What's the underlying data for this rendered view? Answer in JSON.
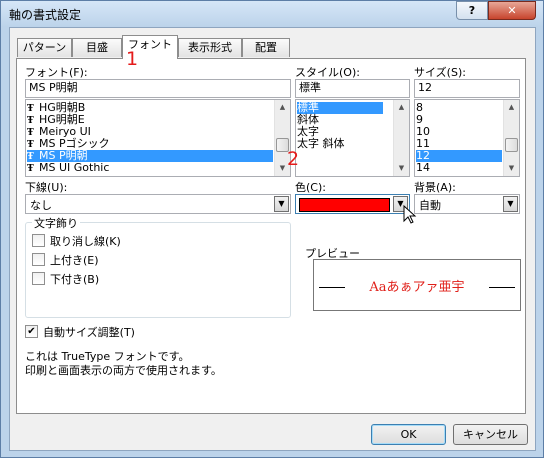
{
  "window": {
    "title": "軸の書式設定",
    "help_label": "?",
    "close_label": "✕"
  },
  "tabs": [
    {
      "label": "パターン"
    },
    {
      "label": "目盛"
    },
    {
      "label": "フォント"
    },
    {
      "label": "表示形式"
    },
    {
      "label": "配置"
    }
  ],
  "annotations": {
    "one": "1",
    "two": "2"
  },
  "font": {
    "label": "フォント(F):",
    "value": "MS P明朝",
    "items": [
      "HG明朝B",
      "HG明朝E",
      "Meiryo UI",
      "MS Pゴシック",
      "MS P明朝",
      "MS UI Gothic"
    ],
    "selected": "MS P明朝"
  },
  "style": {
    "label": "スタイル(O):",
    "value": "標準",
    "items": [
      "標準",
      "斜体",
      "太字",
      "太字 斜体"
    ],
    "selected": "標準"
  },
  "size": {
    "label": "サイズ(S):",
    "value": "12",
    "items": [
      "8",
      "9",
      "10",
      "11",
      "12",
      "14"
    ],
    "selected": "12"
  },
  "underline": {
    "label": "下線(U):",
    "value": "なし"
  },
  "color": {
    "label": "色(C):",
    "swatch": "#ff0000"
  },
  "background": {
    "label": "背景(A):",
    "value": "自動"
  },
  "effects": {
    "title": "文字飾り",
    "strikethrough": "取り消し線(K)",
    "superscript": "上付き(E)",
    "subscript": "下付き(B)"
  },
  "preview": {
    "title": "プレビュー",
    "text": "Aaあぁアァ亜宇"
  },
  "autoscale": {
    "label": "自動サイズ調整(T)",
    "checked": true
  },
  "info": {
    "line1": "これは TrueType フォントです。",
    "line2": "印刷と画面表示の両方で使用されます。"
  },
  "buttons": {
    "ok": "OK",
    "cancel": "キャンセル"
  },
  "colors": {
    "selection": "#3399ff",
    "annotation": "#e41b1b",
    "preview_text": "#e0201a"
  }
}
